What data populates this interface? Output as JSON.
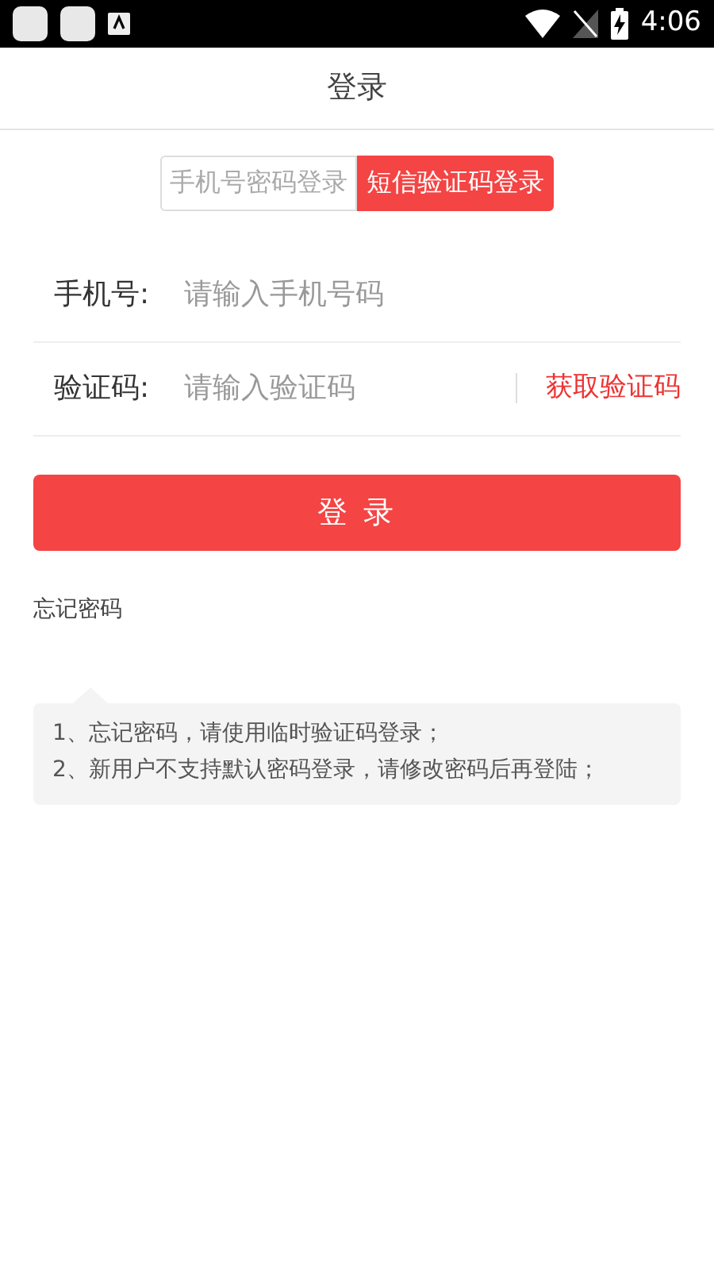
{
  "status_bar": {
    "time": "4:06"
  },
  "header": {
    "title": "登录"
  },
  "tabs": [
    {
      "label": "手机号密码登录",
      "selected": false
    },
    {
      "label": "短信验证码登录",
      "selected": true
    }
  ],
  "fields": [
    {
      "kind": "plain",
      "label": "手机号:",
      "placeholder": "请输入手机号码"
    },
    {
      "kind": "code",
      "label": "验证码:",
      "placeholder": "请输入验证码",
      "action": "获取验证码"
    }
  ],
  "submit": "登 录",
  "forgot_link": "忘记密码",
  "tips": [
    "1、忘记密码，请使用临时验证码登录；",
    "2、新用户不支持默认密码登录，请修改密码后再登陆；"
  ]
}
